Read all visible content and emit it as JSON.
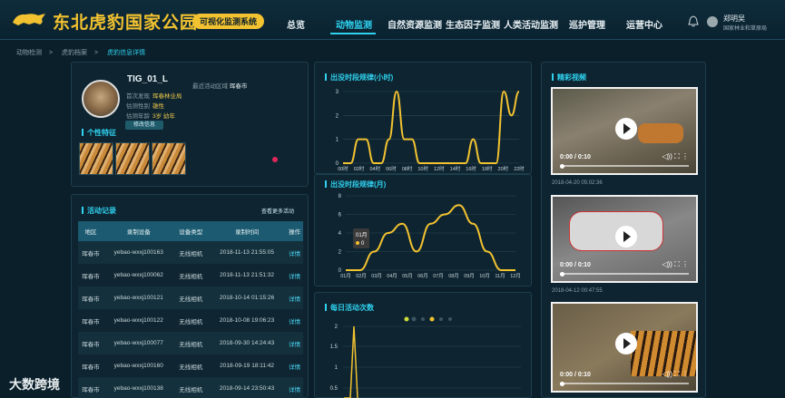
{
  "header": {
    "brand": "东北虎豹国家公园",
    "badge": "可视化监测系统",
    "nav": [
      "总览",
      "动物监测",
      "自然资源监测",
      "生态因子监测",
      "人类活动监测",
      "巡护管理",
      "运营中心"
    ],
    "user_name": "郑明吴",
    "user_org": "国家林业和草原局",
    "accent": "#2fd1ef",
    "brand_color": "#f2c230"
  },
  "breadcrumb": [
    "动物检测",
    "虎豹档案",
    "虎豹信息详情"
  ],
  "profile": {
    "name": "TIG_01_L",
    "recent_area_label": "最近活动区域",
    "recent_area": "珲春市",
    "first_found_label": "首次发现",
    "first_found": "珲春林业局",
    "gender_label": "估测性别",
    "gender": "雄性",
    "age_label": "估测年龄",
    "age": "3岁 幼年",
    "edit_label": "修改信息",
    "features_title": "个性特征"
  },
  "activity": {
    "title": "活动记录",
    "more": "查看更多活动",
    "columns": [
      "地区",
      "录制设备",
      "设备类型",
      "录制时间",
      "操作"
    ],
    "rows": [
      [
        "珲春市",
        "yebao-wxxj100163",
        "无线相机",
        "2018-11-13 21:55:05",
        "详情"
      ],
      [
        "珲春市",
        "yebao-wxxj100062",
        "无线相机",
        "2018-11-13 21:51:32",
        "详情"
      ],
      [
        "珲春市",
        "yebao-wxxj100121",
        "无线相机",
        "2018-10-14 01:15:26",
        "详情"
      ],
      [
        "珲春市",
        "yebao-wxxj100122",
        "无线相机",
        "2018-10-08 19:06:23",
        "详情"
      ],
      [
        "珲春市",
        "yebao-wxxj100077",
        "无线相机",
        "2018-09-30 14:24:43",
        "详情"
      ],
      [
        "珲春市",
        "yebao-wxxj100160",
        "无线相机",
        "2018-09-19 18:11:42",
        "详情"
      ],
      [
        "珲春市",
        "yebao-wxxj100138",
        "无线相机",
        "2018-09-14 23:50:43",
        "详情"
      ]
    ]
  },
  "hourly": {
    "title": "出没时段规律(小时)",
    "x": [
      "00时",
      "02时",
      "04时",
      "06时",
      "08时",
      "10时",
      "12时",
      "14时",
      "16时",
      "18时",
      "20时",
      "22时"
    ],
    "yticks": [
      0,
      1,
      2,
      3
    ],
    "values": [
      0,
      0,
      1,
      1,
      0,
      0,
      1,
      3,
      1,
      1,
      0,
      0,
      0,
      0,
      0,
      0,
      0,
      1,
      0,
      0,
      0,
      3,
      2,
      3
    ]
  },
  "monthly": {
    "title": "出没时段规律(月)",
    "x": [
      "01月",
      "02月",
      "03月",
      "04月",
      "05月",
      "06月",
      "07月",
      "08月",
      "09月",
      "10月",
      "11月",
      "12月"
    ],
    "yticks": [
      0,
      2,
      4,
      6,
      8
    ],
    "values": [
      0,
      0,
      2,
      4,
      5,
      2,
      5,
      6,
      7,
      5,
      2,
      0,
      0
    ],
    "tooltip_label": "01月",
    "tooltip_value": "0"
  },
  "daily": {
    "title": "每日活动次数",
    "yticks": [
      "0.5",
      "1",
      "1.5",
      "2"
    ]
  },
  "videos": {
    "title": "精彩视频",
    "time": "0:00 / 0:10",
    "dates": [
      "2018-04-20 05:02:36",
      "2018-04-12 00:47:55"
    ]
  },
  "watermark": "大数跨境"
}
